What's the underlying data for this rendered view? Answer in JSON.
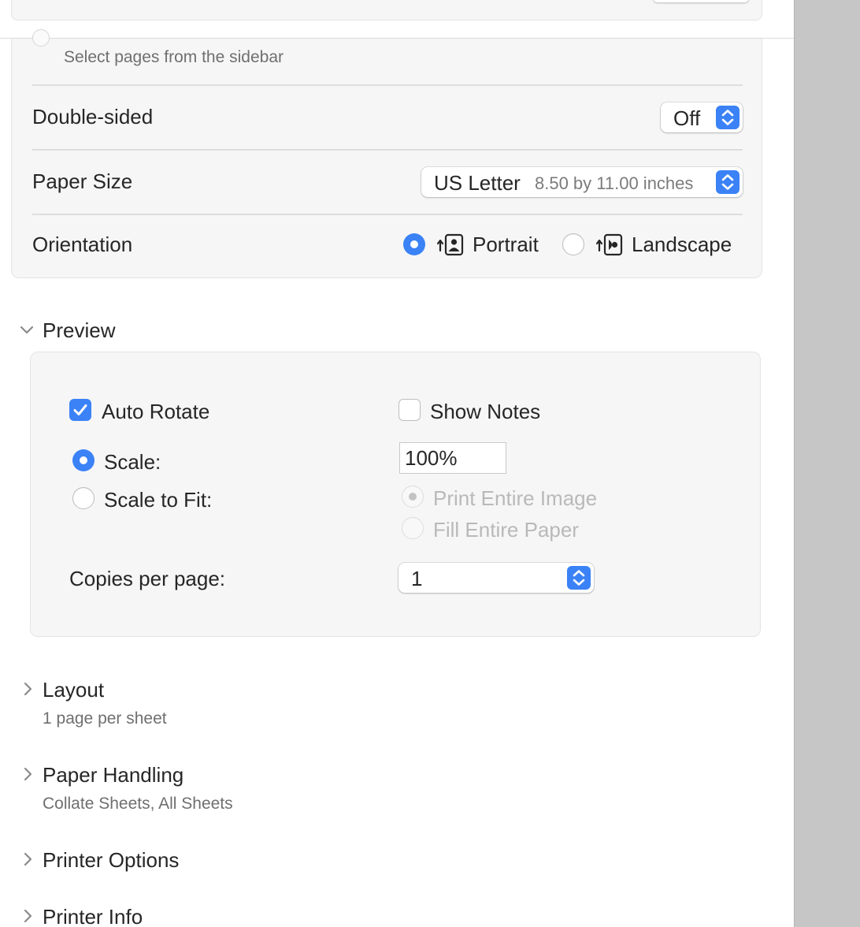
{
  "colors": {
    "accent": "#3a82f6",
    "card_bg": "#f6f6f6",
    "disabled_text": "#b9b9b9"
  },
  "pages": {
    "hint": "Select pages from the sidebar"
  },
  "double_sided": {
    "label": "Double-sided",
    "value": "Off"
  },
  "paper_size": {
    "label": "Paper Size",
    "value": "US Letter",
    "dimensions": "8.50 by 11.00 inches"
  },
  "orientation": {
    "label": "Orientation",
    "options": [
      {
        "label": "Portrait",
        "icon": "portrait-icon",
        "selected": true
      },
      {
        "label": "Landscape",
        "icon": "landscape-icon",
        "selected": false
      }
    ]
  },
  "preview": {
    "title": "Preview",
    "expanded": true,
    "auto_rotate": {
      "label": "Auto Rotate",
      "checked": true
    },
    "show_notes": {
      "label": "Show Notes",
      "checked": false
    },
    "scale": {
      "label": "Scale:",
      "selected": true,
      "value": "100%"
    },
    "scale_to_fit": {
      "label": "Scale to Fit:",
      "selected": false,
      "options": [
        {
          "label": "Print Entire Image",
          "selected": true,
          "enabled": false
        },
        {
          "label": "Fill Entire Paper",
          "selected": false,
          "enabled": false
        }
      ]
    },
    "copies_per_page": {
      "label": "Copies per page:",
      "value": "1"
    }
  },
  "sections": [
    {
      "title": "Layout",
      "summary": "1 page per sheet"
    },
    {
      "title": "Paper Handling",
      "summary": "Collate Sheets, All Sheets"
    },
    {
      "title": "Printer Options",
      "summary": ""
    },
    {
      "title": "Printer Info",
      "summary": ""
    }
  ]
}
